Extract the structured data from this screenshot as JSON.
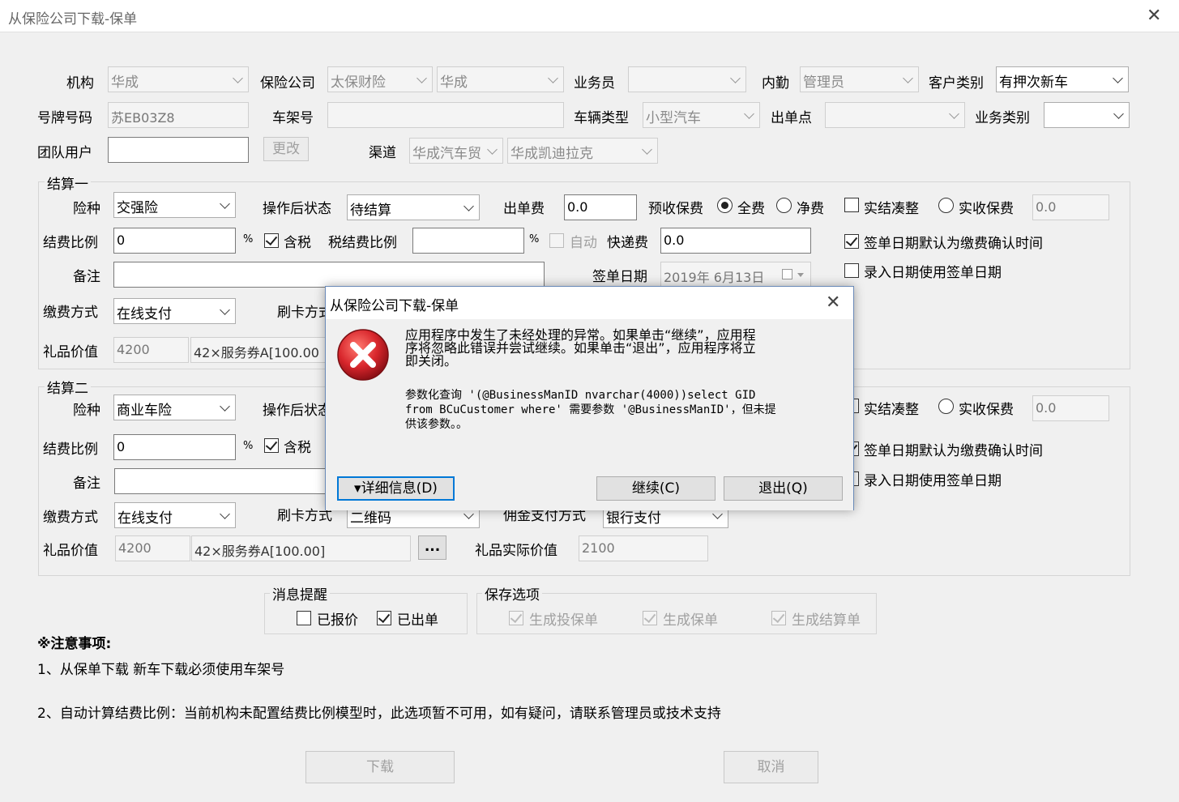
{
  "window": {
    "title": "从保险公司下载-保单"
  },
  "row1": {
    "org_label": "机构",
    "org_value": "华成",
    "insurer_label": "保险公司",
    "insurer_value": "太保财险",
    "insurer_branch_value": "华成",
    "agent_label": "业务员",
    "agent_value": "",
    "internal_label": "内勤",
    "internal_value": "管理员",
    "customer_type_label": "客户类别",
    "customer_type_value": "有押次新车"
  },
  "row2": {
    "plate_label": "号牌号码",
    "plate_value": "苏EB03Z8",
    "vin_label": "车架号",
    "vin_value": "",
    "vehicle_type_label": "车辆类型",
    "vehicle_type_value": "小型汽车",
    "issue_point_label": "出单点",
    "issue_point_value": "",
    "biz_type_label": "业务类别",
    "biz_type_value": ""
  },
  "row3": {
    "team_label": "团队用户",
    "team_value": "",
    "change_button": "更改",
    "channel_label": "渠道",
    "channel_value": "华成汽车贸",
    "channel_sub_value": "华成凯迪拉克"
  },
  "settle1": {
    "group_title": "结算一",
    "risk_label": "险种",
    "risk_value": "交强险",
    "status_label": "操作后状态",
    "status_value": "待结算",
    "fee_label": "出单费",
    "fee_value": "0.0",
    "prepay_label": "预收保费",
    "full_label": "全费",
    "net_label": "净费",
    "round_label": "实结凑整",
    "actual_label": "实收保费",
    "actual_value": "0.0",
    "ratio_label": "结费比例",
    "ratio_value": "0",
    "percent": "%",
    "tax_label": "含税",
    "tax_ratio_label": "税结费比例",
    "tax_ratio_value": "",
    "auto_label": "自动",
    "express_label": "快递费",
    "express_value": "0.0",
    "sign_default_label": "签单日期默认为缴费确认时间",
    "remark_label": "备注",
    "remark_value": "",
    "sign_date_label": "签单日期",
    "sign_date_value": "2019年 6月13日",
    "entry_date_label": "录入日期使用签单日期",
    "pay_label": "缴费方式",
    "pay_value": "在线支付",
    "card_label": "刷卡方式",
    "gift_label": "礼品价值",
    "gift_value": "4200",
    "gift_desc": "42×服务券A[100.00"
  },
  "settle2": {
    "group_title": "结算二",
    "risk_label": "险种",
    "risk_value": "商业车险",
    "status_label": "操作后状态",
    "round_label": "实结凑整",
    "actual_label": "实收保费",
    "actual_value": "0.0",
    "ratio_label": "结费比例",
    "ratio_value": "0",
    "percent": "%",
    "tax_label": "含税",
    "sign_default_label": "签单日期默认为缴费确认时间",
    "remark_label": "备注",
    "remark_value": "",
    "entry_date_label": "录入日期使用签单日期",
    "pay_label": "缴费方式",
    "pay_value": "在线支付",
    "card_label": "刷卡方式",
    "card_value": "二维码",
    "commission_label": "佣金支付方式",
    "commission_value": "银行支付",
    "gift_label": "礼品价值",
    "gift_value": "4200",
    "gift_desc": "42×服务券A[100.00]",
    "more_button": "...",
    "gift_actual_label": "礼品实际价值",
    "gift_actual_value": "2100"
  },
  "msg": {
    "title": "消息提醒",
    "quoted_label": "已报价",
    "issued_label": "已出单"
  },
  "save": {
    "title": "保存选项",
    "opt1": "生成投保单",
    "opt2": "生成保单",
    "opt3": "生成结算单"
  },
  "notes": {
    "heading": "※注意事项:",
    "line1": "1、从保单下载 新车下载必须使用车架号",
    "line2": "2、自动计算结费比例：当前机构未配置结费比例模型时，此选项暂不可用，如有疑问，请联系管理员或技术支持"
  },
  "footer": {
    "download_button": "下载",
    "cancel_button": "取消"
  },
  "dialog": {
    "title": "从保险公司下载-保单",
    "msg1_line1": "应用程序中发生了未经处理的异常。如果单击“继续”，应用程",
    "msg1_line2": "序将忽略此错误并尝试继续。如果单击“退出”，应用程序将立",
    "msg1_line3": "即关闭。",
    "msg2_line1": "参数化查询 '(@BusinessManID nvarchar(4000))select GID",
    "msg2_line2": "from BCuCustomer where' 需要参数 '@BusinessManID'，但未提",
    "msg2_line3": "供该参数。。",
    "details_button": "▾详细信息(D)",
    "continue_button": "继续(C)",
    "quit_button": "退出(Q)"
  },
  "colors": {
    "error_red": "#d8262c",
    "focus_blue": "#0078d7",
    "dialog_border": "#6a8ab8"
  }
}
